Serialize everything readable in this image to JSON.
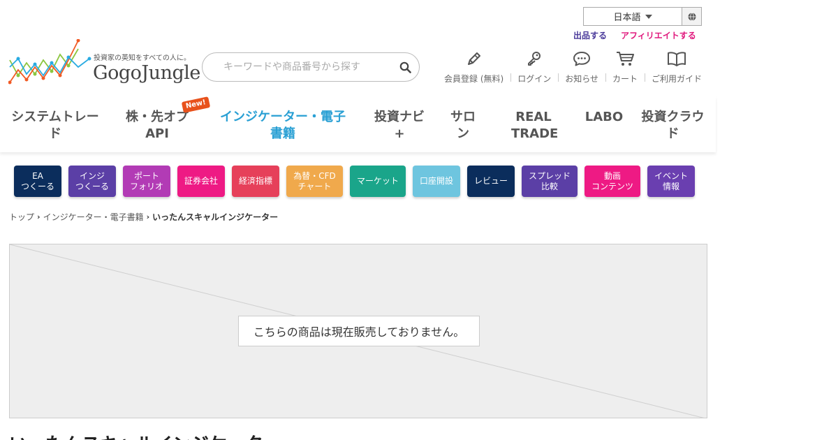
{
  "header": {
    "language": "日本語",
    "sell_link": "出品する",
    "affiliate_link": "アフィリエイトする",
    "logo_tagline": "投資家の英知をすべての人に。",
    "logo_name": "GogoJungle",
    "search_placeholder": "キーワードや商品番号から探す"
  },
  "user_menu": [
    {
      "label": "会員登録 (無料)",
      "icon": "pencil-icon"
    },
    {
      "label": "ログイン",
      "icon": "key-icon"
    },
    {
      "label": "お知らせ",
      "icon": "chat-bubble-icon"
    },
    {
      "label": "カート",
      "icon": "cart-icon"
    },
    {
      "label": "ご利用ガイド",
      "icon": "book-icon"
    }
  ],
  "nav": {
    "items": [
      {
        "label": "システムトレード"
      },
      {
        "label": "株・先オプAPI",
        "badge": "New!"
      },
      {
        "label": "インジケーター・電子書籍",
        "active": true
      },
      {
        "label": "投資ナビ+"
      },
      {
        "label": "サロン"
      },
      {
        "label": "REAL TRADE"
      },
      {
        "label": "LABO"
      },
      {
        "label": "投資クラウド"
      }
    ]
  },
  "categories": [
    {
      "label": "EA\nつくーる",
      "color": "#0b2d5c"
    },
    {
      "label": "インジ\nつくーる",
      "color": "#5b3fa6"
    },
    {
      "label": "ポート\nフォリオ",
      "color": "#b23bb5"
    },
    {
      "label": "証券会社",
      "color": "#ee1a84"
    },
    {
      "label": "経済指標",
      "color": "#e6405a"
    },
    {
      "label": "為替・CFD\nチャート",
      "color": "#f0a94c"
    },
    {
      "label": "マーケット",
      "color": "#1aa58a"
    },
    {
      "label": "口座開設",
      "color": "#6ec5df"
    },
    {
      "label": "レビュー",
      "color": "#0b2d5c"
    },
    {
      "label": "スプレッド\n比較",
      "color": "#5b3fa6"
    },
    {
      "label": "動画\nコンテンツ",
      "color": "#ee1a84"
    },
    {
      "label": "イベント\n情報",
      "color": "#6a3fb0"
    }
  ],
  "breadcrumb": {
    "home": "トップ",
    "category": "インジケーター・電子書籍",
    "current": "いったんスキャルインジケーター"
  },
  "product": {
    "notice": "こちらの商品は現在販売しておりません。",
    "title": "いったんスキャルインジケーター"
  },
  "colors": {
    "accent": "#2aa0d4",
    "sell_link": "#4a3a9a",
    "affiliate_link": "#e0197d"
  }
}
